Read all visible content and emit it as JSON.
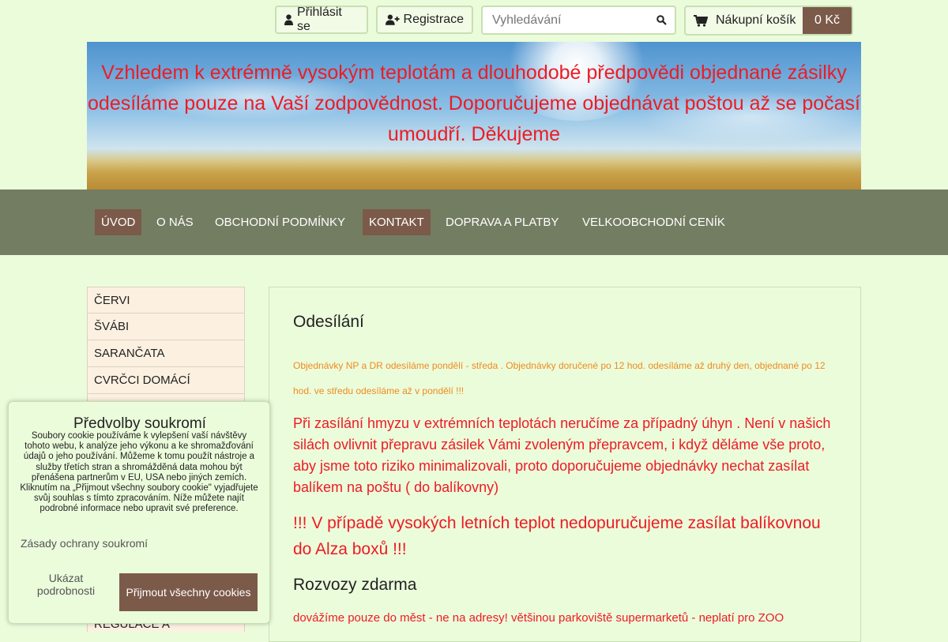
{
  "header": {
    "login_label": "Přihlásit se",
    "register_label": "Registrace",
    "search_placeholder": "Vyhledávání",
    "cart_label": "Nákupní košík",
    "cart_price": "0 Kč"
  },
  "banner": {
    "message": "Vzhledem k extrémně vysokým teplotám a dlouhodobé předpovědi objednané zásilky odesíláme pouze na Vaší zodpovědnost. Doporučujeme objednávat poštou až se počasí umoudří. Děkujeme"
  },
  "nav": {
    "items": [
      {
        "label": "ÚVOD",
        "active": true
      },
      {
        "label": "O NÁS",
        "active": false
      },
      {
        "label": "OBCHODNÍ PODMÍNKY",
        "active": false
      },
      {
        "label": "KONTAKT",
        "active": true
      },
      {
        "label": "DOPRAVA A PLATBY",
        "active": false
      },
      {
        "label": "VELKOOBCHODNÍ CENÍK",
        "active": false
      }
    ]
  },
  "sidebar": {
    "items": [
      "ČERVI",
      "ŠVÁBI",
      "SARANČATA",
      "CVRČCI DOMÁCÍ",
      "",
      "",
      "",
      "",
      "",
      "",
      "",
      ""
    ],
    "bottom_item": "REGULACE A"
  },
  "content": {
    "heading": "Odesílání",
    "orange_note": "Objednávky NP a DR odesíláme pondělí - středa . Objednávky doručené po 12 hod. odesíláme až druhý den, objednané po 12 hod. ve středu odesíláme až v pondělí !!!",
    "red_paragraph": "Při zasílání hmyzu v extrémních teplotách neručíme za případný úhyn . Není v našich silách ovlivnit přepravu zásilek Vámi zvoleným přepravcem, i když děláme vše proto, aby jsme toto riziko minimalizovali, proto doporučujeme objednávky nechat zasílat balíkem na poštu ( do balíkovny)",
    "red_big": "!!! V případě vysokých letních teplot nedopuručujeme zasílat balíkovnou do Alza boxů !!!",
    "subheading": "Rozvozy zdarma",
    "red_small": "dovážíme pouze do měst - ne na adresy! většinou parkoviště supermarketů - neplatí pro ZOO"
  },
  "cookie": {
    "title": "Předvolby soukromí",
    "text": "Soubory cookie používáme k vylepšení vaší návštěvy tohoto webu, k analýze jeho výkonu a ke shromažďování údajů o jeho používání. Můžeme k tomu použít nástroje a služby třetích stran a shromážděná data mohou být přenášena partnerům v EU, USA nebo jiných zemích. Kliknutím na „Přijmout všechny soubory cookie\" vyjadřujete svůj souhlas s tímto zpracováním. Níže můžete najít podrobné informace nebo upravit své preference.",
    "privacy_link": "Zásady ochrany soukromí",
    "details_label": "Ukázat podrobnosti",
    "accept_label": "Přijmout všechny cookies"
  },
  "colors": {
    "background": "#ebfcdb",
    "accent_brown": "#7b5a4a",
    "nav_bar": "#737d62",
    "alert_red": "#ee1b24",
    "note_orange": "#f08a1e"
  }
}
